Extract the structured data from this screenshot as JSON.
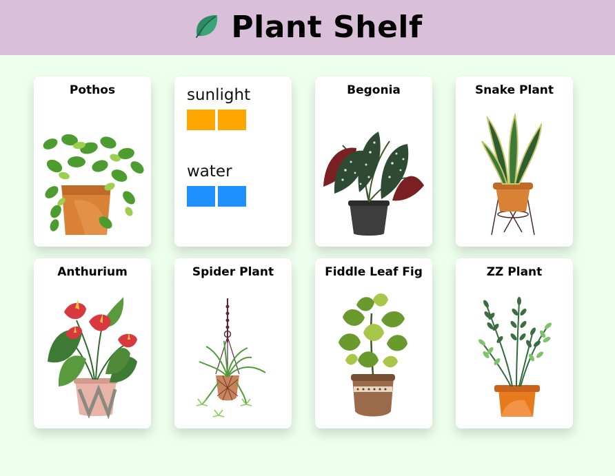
{
  "header": {
    "title": "Plant Shelf",
    "icon": "leaf-icon"
  },
  "colors": {
    "header_bg": "#d9bfd9",
    "page_bg": "#efffef",
    "sunlight": "#ffa500",
    "water": "#1e90ff"
  },
  "stats_card": {
    "sunlight_label": "sunlight",
    "sunlight_level": 2,
    "water_label": "water",
    "water_level": 2
  },
  "plants": [
    {
      "name": "Pothos"
    },
    {
      "name": "Begonia"
    },
    {
      "name": "Snake Plant"
    },
    {
      "name": "Anthurium"
    },
    {
      "name": "Spider Plant"
    },
    {
      "name": "Fiddle Leaf Fig"
    },
    {
      "name": "ZZ Plant"
    }
  ]
}
